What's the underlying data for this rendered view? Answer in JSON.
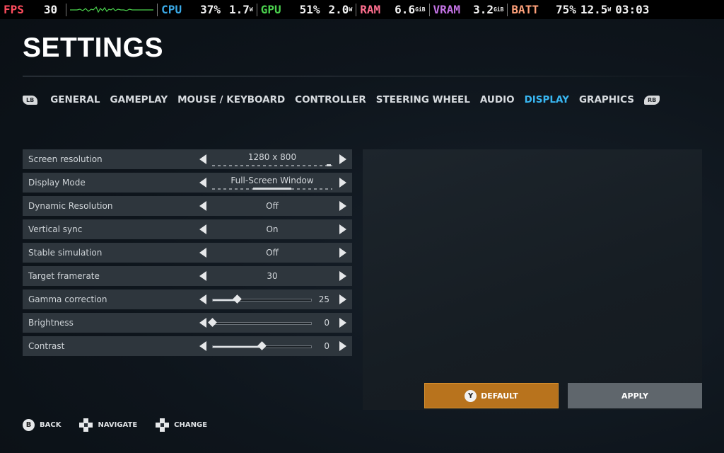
{
  "overlay": {
    "fps": {
      "label": "FPS",
      "value": "30"
    },
    "cpu": {
      "label": "CPU",
      "percent": "37%",
      "watts": "1.7",
      "unit": "W"
    },
    "gpu": {
      "label": "GPU",
      "percent": "51%",
      "watts": "2.0",
      "unit": "W"
    },
    "ram": {
      "label": "RAM",
      "value": "6.6",
      "unit": "GiB"
    },
    "vram": {
      "label": "VRAM",
      "value": "3.2",
      "unit": "GiB"
    },
    "batt": {
      "label": "BATT",
      "percent": "75%",
      "watts": "12.5",
      "unit": "W"
    },
    "clock": "03:03"
  },
  "title": "SETTINGS",
  "tabs": {
    "left_bumper": "LB",
    "right_bumper": "RB",
    "items": [
      "GENERAL",
      "GAMEPLAY",
      "MOUSE / KEYBOARD",
      "CONTROLLER",
      "STEERING WHEEL",
      "AUDIO",
      "DISPLAY",
      "GRAPHICS"
    ],
    "active": "DISPLAY"
  },
  "settings": [
    {
      "label": "Screen resolution",
      "value": "1280 x 800",
      "type": "select"
    },
    {
      "label": "Display Mode",
      "value": "Full-Screen Window",
      "type": "select"
    },
    {
      "label": "Dynamic Resolution",
      "value": "Off",
      "type": "select"
    },
    {
      "label": "Vertical sync",
      "value": "On",
      "type": "select"
    },
    {
      "label": "Stable simulation",
      "value": "Off",
      "type": "select"
    },
    {
      "label": "Target framerate",
      "value": "30",
      "type": "select"
    },
    {
      "label": "Gamma correction",
      "value": "25",
      "type": "slider",
      "level": 0.25
    },
    {
      "label": "Brightness",
      "value": "0",
      "type": "slider",
      "level": 0.0
    },
    {
      "label": "Contrast",
      "value": "0",
      "type": "slider",
      "level": 0.5
    }
  ],
  "buttons": {
    "default_label": "DEFAULT",
    "default_glyph": "Y",
    "apply_label": "APPLY"
  },
  "hints": {
    "back": {
      "glyph": "B",
      "label": "BACK"
    },
    "navigate": {
      "label": "NAVIGATE"
    },
    "change": {
      "label": "CHANGE"
    }
  },
  "colors": {
    "accent": "#39b7f2",
    "default_button": "#b8731d",
    "apply_button": "#5f666c",
    "row_bg": "#2e363d"
  }
}
